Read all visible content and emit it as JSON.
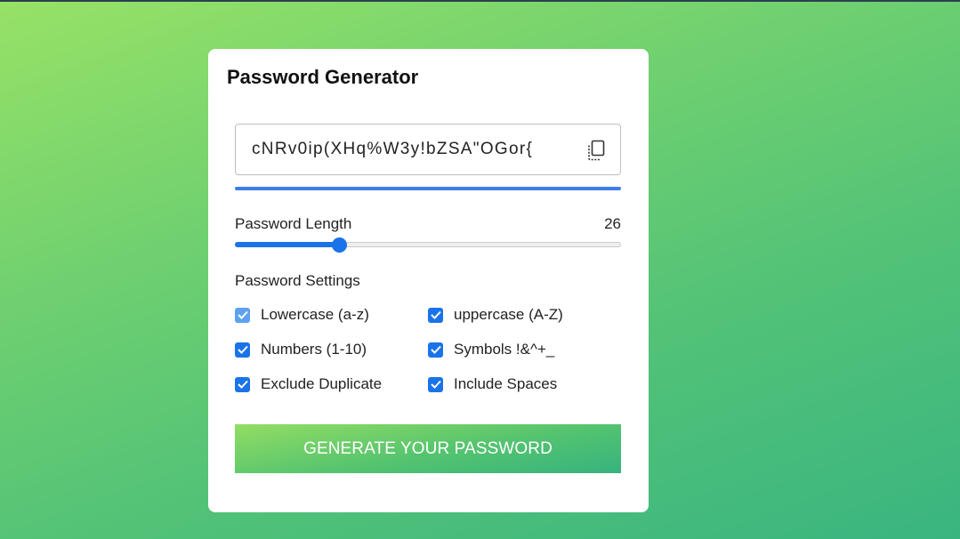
{
  "app": {
    "title": "Password Generator"
  },
  "password": {
    "value": "cNRv0ip(XHq%W3y!bZSA\"OGor{",
    "copy_icon": "copy-icon",
    "strength_fraction": 1.0
  },
  "length": {
    "label": "Password Length",
    "value": "26",
    "slider_fraction": 0.27
  },
  "settings": {
    "label": "Password Settings",
    "options": [
      {
        "label": "Lowercase (a-z)",
        "checked": true,
        "disabled": true
      },
      {
        "label": "uppercase (A-Z)",
        "checked": true,
        "disabled": false
      },
      {
        "label": "Numbers (1-10)",
        "checked": true,
        "disabled": false
      },
      {
        "label": "Symbols !&^+_",
        "checked": true,
        "disabled": false
      },
      {
        "label": "Exclude Duplicate",
        "checked": true,
        "disabled": false
      },
      {
        "label": "Include Spaces",
        "checked": true,
        "disabled": false
      }
    ]
  },
  "generate": {
    "label": "GENERATE YOUR PASSWORD"
  },
  "colors": {
    "accent": "#1a73e8",
    "strength": "#3f7de8",
    "card": "#ffffff",
    "gradient_start": "#97e266",
    "gradient_end": "#3ab580"
  }
}
